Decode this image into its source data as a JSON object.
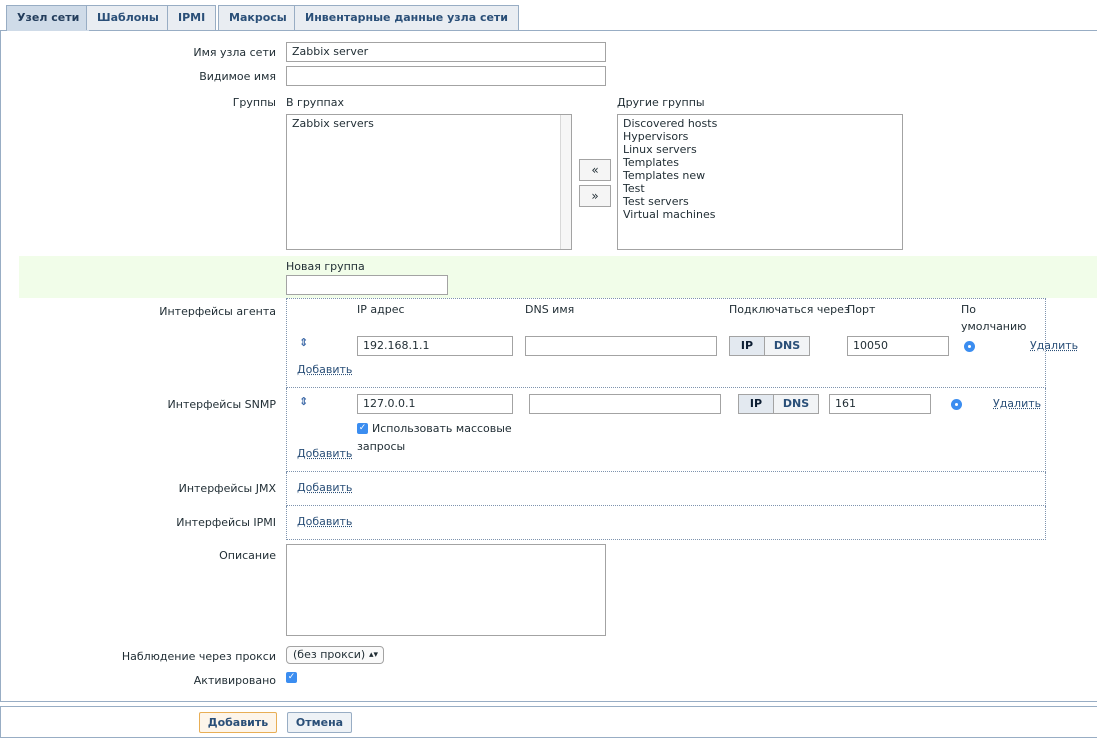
{
  "tabs": [
    "Узел сети",
    "Шаблоны",
    "IPMI",
    "Макросы",
    "Инвентарные данные узла сети"
  ],
  "form": {
    "host_name_label": "Имя узла сети",
    "host_name_value": "Zabbix server",
    "visible_name_label": "Видимое имя",
    "visible_name_value": "",
    "groups_label": "Группы",
    "in_groups_label": "В группах",
    "in_groups": [
      "Zabbix servers"
    ],
    "other_groups_label": "Другие группы",
    "other_groups": [
      "Discovered hosts",
      "Hypervisors",
      "Linux servers",
      "Templates",
      "Templates new",
      "Test",
      "Test servers",
      "Virtual machines"
    ],
    "move_left": "«",
    "move_right": "»",
    "new_group_label": "Новая группа",
    "new_group_value": ""
  },
  "interfaces": {
    "agent_label": "Интерфейсы агента",
    "col_ip": "IP адрес",
    "col_dns": "DNS имя",
    "col_connect": "Подключаться через",
    "col_port": "Порт",
    "col_default_1": "По",
    "col_default_2": "умолчанию",
    "agent": {
      "ip": "192.168.1.1",
      "dns": "",
      "port": "10050"
    },
    "snmp_label": "Интерфейсы SNMP",
    "snmp": {
      "ip": "127.0.0.1",
      "dns": "",
      "port": "161"
    },
    "bulk_line1": "Использовать массовые",
    "bulk_line2": "запросы",
    "jmx_label": "Интерфейсы JMX",
    "ipmi_label": "Интерфейсы IPMI",
    "seg_ip": "IP",
    "seg_dns": "DNS",
    "remove": "Удалить",
    "add": "Добавить",
    "drag_glyph": "⇕"
  },
  "description_label": "Описание",
  "description_value": "",
  "proxy_label": "Наблюдение через прокси",
  "proxy_value": "(без прокси)",
  "enabled_label": "Активировано",
  "check_glyph": "✓",
  "buttons": {
    "add": "Добавить",
    "cancel": "Отмена"
  },
  "colors": {
    "accent": "#3b8df0",
    "tab_border": "#98adc4",
    "link": "#2a4f78",
    "new_group_bg": "#f1fde9"
  }
}
